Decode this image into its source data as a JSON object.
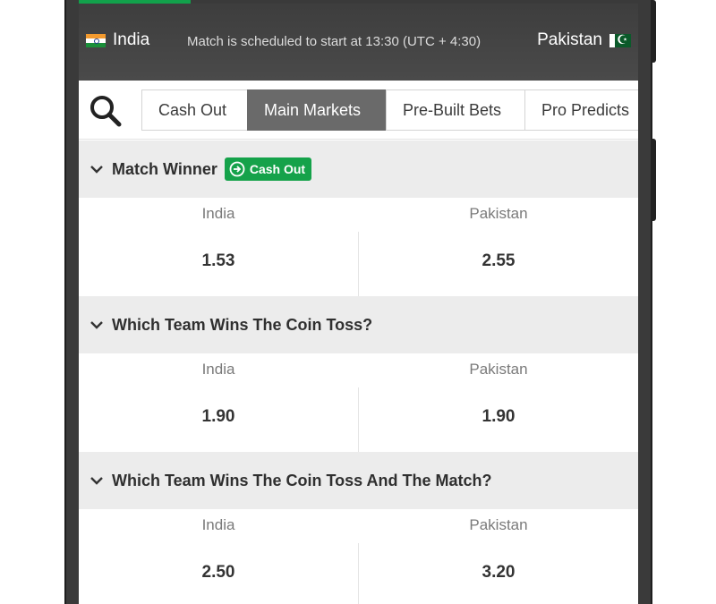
{
  "match": {
    "home_team": "India",
    "away_team": "Pakistan",
    "status": "Match is scheduled to start at 13:30 (UTC + 4:30)",
    "progress_fraction": 0.2
  },
  "tabs": [
    {
      "label": "Cash Out",
      "active": false
    },
    {
      "label": "Main Markets",
      "active": true
    },
    {
      "label": "Pre-Built Bets",
      "active": false
    },
    {
      "label": "Pro Predicts",
      "active": false
    }
  ],
  "markets": [
    {
      "title": "Match Winner",
      "badge": "Cash Out",
      "selections": [
        {
          "name": "India",
          "odds": "1.53"
        },
        {
          "name": "Pakistan",
          "odds": "2.55"
        }
      ]
    },
    {
      "title": "Which Team Wins The Coin Toss?",
      "selections": [
        {
          "name": "India",
          "odds": "1.90"
        },
        {
          "name": "Pakistan",
          "odds": "1.90"
        }
      ]
    },
    {
      "title": "Which Team Wins The Coin Toss And The Match?",
      "selections": [
        {
          "name": "India",
          "odds": "2.50"
        },
        {
          "name": "Pakistan",
          "odds": "3.20"
        }
      ]
    }
  ],
  "colors": {
    "accent_green": "#15a24a",
    "header_dark": "#3d3d3d",
    "active_tab": "#6a6a6a"
  },
  "icons": {
    "search": "search-icon",
    "chevron": "chevron-down-icon",
    "cashout": "cash-out-icon"
  }
}
